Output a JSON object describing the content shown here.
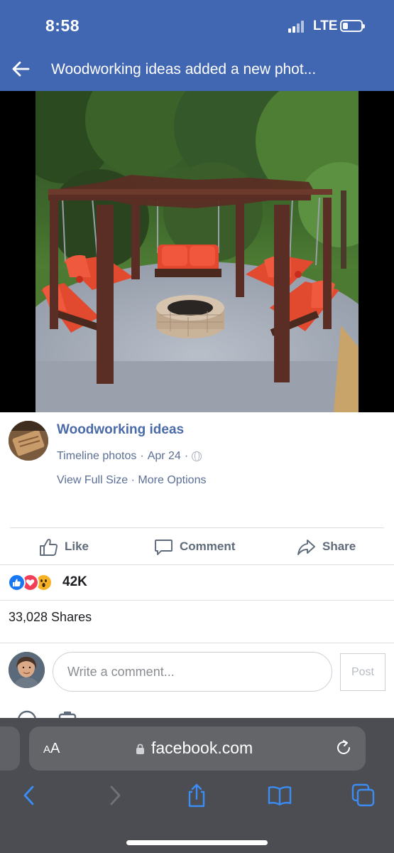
{
  "status_bar": {
    "time": "8:58",
    "network": "LTE"
  },
  "header": {
    "title": "Woodworking ideas added a new phot..."
  },
  "post": {
    "page_name": "Woodworking ideas",
    "source": "Timeline photos",
    "date": "Apr 24",
    "separator": "·",
    "view_full_size": "View Full Size",
    "more_options": "More Options"
  },
  "actions": {
    "like": "Like",
    "comment": "Comment",
    "share": "Share"
  },
  "reactions": {
    "count": "42K"
  },
  "shares": {
    "text": "33,028 Shares"
  },
  "comment_box": {
    "placeholder": "Write a comment...",
    "post_label": "Post"
  },
  "browser": {
    "text_size": "AA",
    "url": "facebook.com"
  },
  "colors": {
    "header_bg": "#4267b2",
    "link": "#4b6aa8",
    "safari_bg": "#4b4d52"
  }
}
